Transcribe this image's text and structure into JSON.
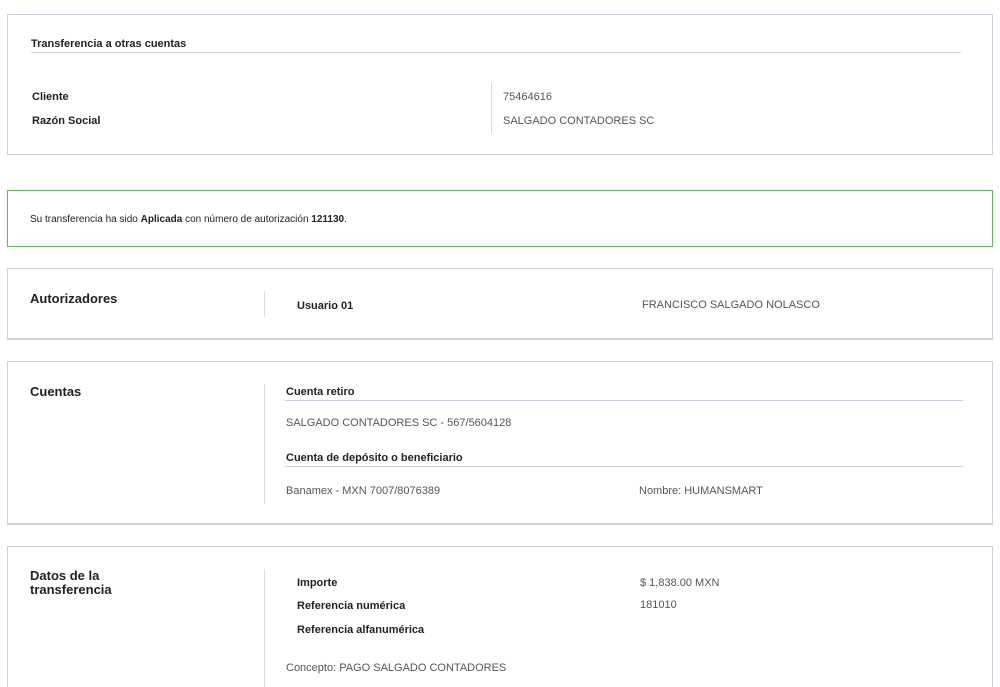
{
  "header": {
    "title": "Transferencia a otras cuentas",
    "client_label": "Cliente",
    "client_value": "75464616",
    "razon_label": "Razón Social",
    "razon_value": "SALGADO CONTADORES SC"
  },
  "success": {
    "prefix": "Su transferencia ha sido ",
    "status": "Aplicada",
    "middle": " con número de autorización ",
    "auth_number": "121130",
    "suffix": ".",
    "border_color": "#5cb85c"
  },
  "autorizadores": {
    "title": "Autorizadores",
    "user_label": "Usuario 01",
    "user_name": "FRANCISCO SALGADO NOLASCO"
  },
  "cuentas": {
    "title": "Cuentas",
    "retiro_label": "Cuenta retiro",
    "retiro_value": "SALGADO CONTADORES SC - 567/5604128",
    "deposito_label": "Cuenta de depósito o beneficiario",
    "deposito_value": "Banamex - MXN 7007/8076389",
    "nombre_value": "Nombre: HUMANSMART"
  },
  "datos": {
    "title_line1": "Datos de la",
    "title_line2": "transferencia",
    "importe_label": "Importe",
    "importe_value": "$ 1,838.00 MXN",
    "ref_num_label": "Referencia numérica",
    "ref_num_value": "181010",
    "ref_alfa_label": "Referencia alfanumérica",
    "concepto": "Concepto: PAGO SALGADO CONTADORES"
  }
}
